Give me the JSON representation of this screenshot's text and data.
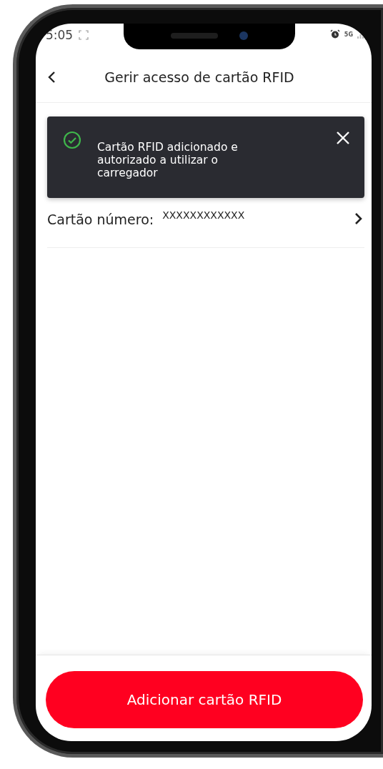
{
  "status_bar": {
    "time": "5:05",
    "network": "5G"
  },
  "header": {
    "title": "Gerir acesso de cartão RFID"
  },
  "toast": {
    "message": "Cartão RFID adicionado e autorizado a utilizar o carregador"
  },
  "cards": [
    {
      "label": "Cartão número:",
      "value": "XXXXXXXXXXXX"
    }
  ],
  "primary_button": {
    "label": "Adicionar cartão RFID"
  }
}
